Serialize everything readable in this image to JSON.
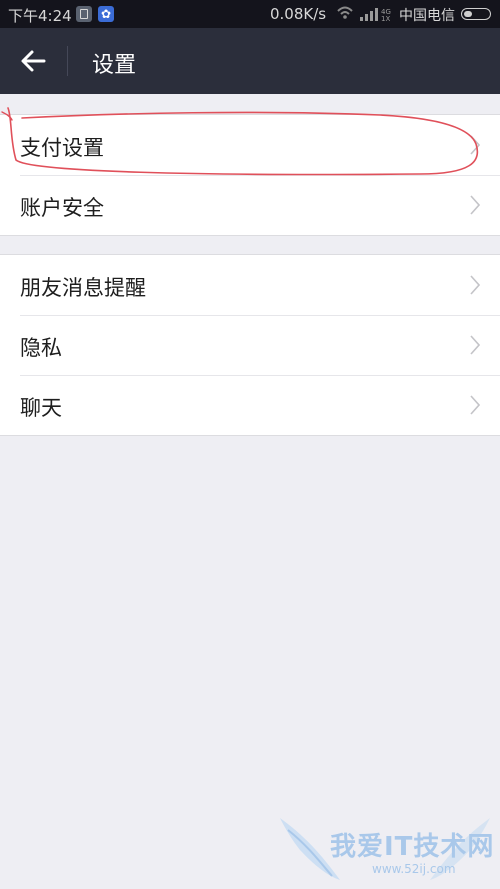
{
  "status_bar": {
    "time": "下午4:24",
    "net_speed": "0.08K/s",
    "carrier": "中国电信",
    "icons": [
      "notification-icon",
      "settings-gear-icon",
      "wifi-icon",
      "signal-icon",
      "battery-icon"
    ]
  },
  "header": {
    "title": "设置",
    "back_icon": "arrow-left-icon"
  },
  "group1": [
    {
      "label": "支付设置"
    },
    {
      "label": "账户安全"
    }
  ],
  "group2": [
    {
      "label": "朋友消息提醒"
    },
    {
      "label": "隐私"
    },
    {
      "label": "聊天"
    }
  ],
  "watermark": {
    "text": "我爱IT技术网",
    "url": "www.52ij.com"
  },
  "colors": {
    "header_bg": "#2b2e3b",
    "page_bg": "#eeeef3",
    "annotation": "#e0505a"
  }
}
